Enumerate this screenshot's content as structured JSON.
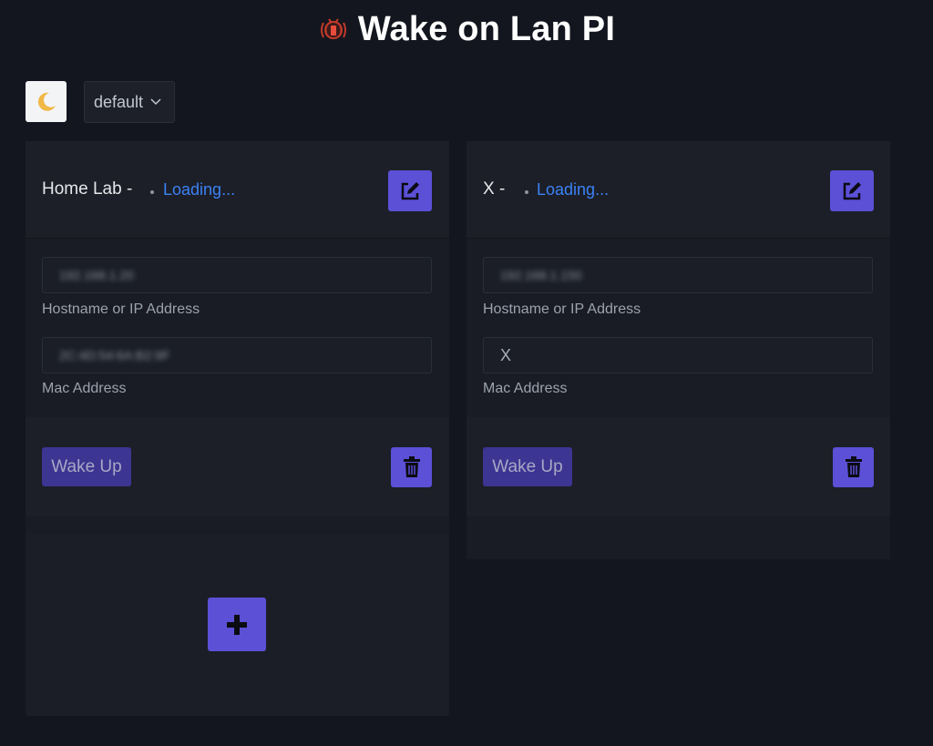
{
  "app": {
    "title": "Wake on Lan PI",
    "logo_icon": "router-signal-icon"
  },
  "toolbar": {
    "theme_icon": "moon-icon",
    "profile_selected": "default"
  },
  "labels": {
    "host": "Hostname or IP Address",
    "mac": "Mac Address",
    "wake": "Wake Up",
    "loading": "Loading..."
  },
  "devices": [
    {
      "name": "Home Lab -",
      "host": "192.168.1.20",
      "mac": "2C:4D:54:6A:B2:9F"
    },
    {
      "name": "X -",
      "host": "192.168.1.150",
      "mac": "X"
    }
  ],
  "colors": {
    "accent": "#5b50d6",
    "wake": "#3c3592",
    "loading": "#3b82f6",
    "background": "#13161e"
  }
}
